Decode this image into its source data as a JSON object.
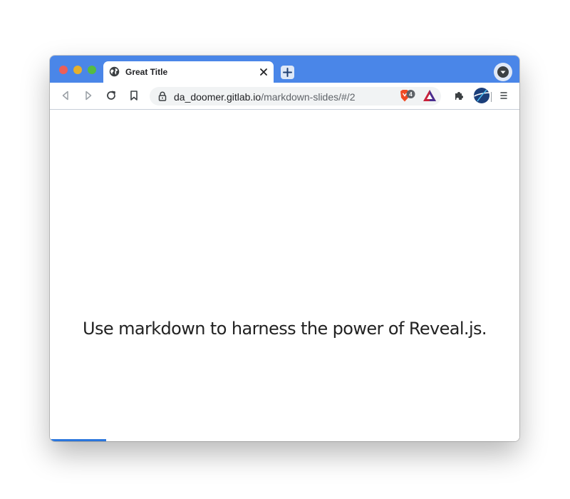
{
  "window": {
    "colors": {
      "frame": "#4a86e8",
      "accent": "#2a76dd"
    }
  },
  "tab": {
    "title": "Great Title",
    "icon": "globe-icon"
  },
  "toolbar": {
    "icons": [
      "back-icon",
      "forward-icon",
      "reload-icon",
      "bookmark-icon",
      "lock-icon",
      "brave-shield-icon",
      "brave-rewards-icon",
      "extensions-icon",
      "profile-avatar-icon",
      "menu-icon"
    ],
    "shields_badge": "4"
  },
  "url": {
    "host": "da_doomer.gitlab.io",
    "path": "/markdown-slides/#/2"
  },
  "slide": {
    "text": "Use markdown to harness the power of Reveal.js.",
    "progress": 0.12
  }
}
